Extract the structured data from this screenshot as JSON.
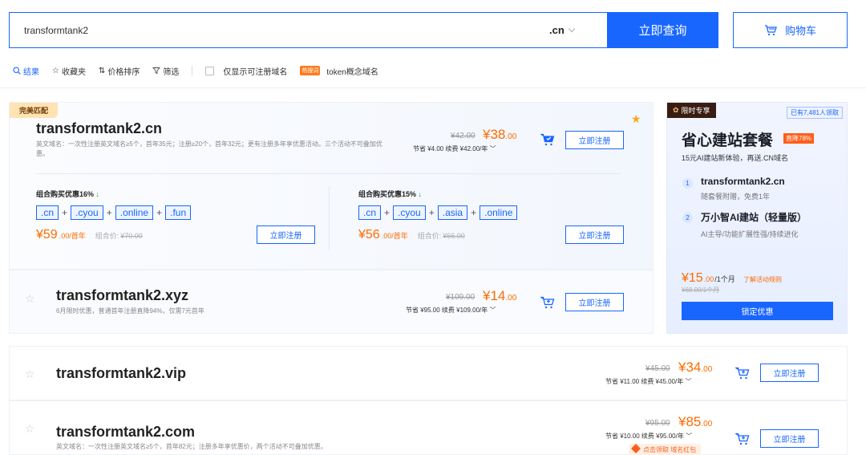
{
  "search": {
    "query": "transformtank2",
    "suffix": ".cn",
    "button_label": "立即查询",
    "cart_label": "购物车"
  },
  "toolbar": {
    "results": "结果",
    "favorites": "收藏夹",
    "sort_price": "价格排序",
    "filter": "筛选",
    "only_registrable": "仅显示可注册域名",
    "hot_badge": "热搜词",
    "token_concept": "token概念域名"
  },
  "exact": {
    "tag": "完美匹配",
    "name": "transformtank2.cn",
    "desc": "英文域名：一次性注册英文域名≥5个，首年35元；注册≥20个，首年32元；更有注册多年享优惠活动。三个活动不可叠加优惠。",
    "old_price": "¥42.00",
    "new_price_int": "¥38",
    "new_price_dec": ".00",
    "save": "节省 ¥4.00  续费 ¥42.00/年",
    "register": "立即注册",
    "bundles": [
      {
        "title": "组合购买优惠16%",
        "tlds": [
          ".cn",
          ".cyou",
          ".online",
          ".fun"
        ],
        "price_int": "¥59",
        "price_unit": ".00/首年",
        "ref_label": "组合价:",
        "ref_price": "¥70.00",
        "register": "立即注册"
      },
      {
        "title": "组合购买优惠15%",
        "tlds": [
          ".cn",
          ".cyou",
          ".asia",
          ".online"
        ],
        "price_int": "¥56",
        "price_unit": ".00/首年",
        "ref_label": "组合价:",
        "ref_price": "¥66.00",
        "register": "立即注册"
      }
    ]
  },
  "rows": [
    {
      "name": "transformtank2.xyz",
      "desc": "6月限时优惠，普通首年注册直降94%，仅需7元首年",
      "old_price": "¥109.00",
      "new_price_int": "¥14",
      "new_price_dec": ".00",
      "save": "节省 ¥95.00  续费 ¥109.00/年",
      "register": "立即注册"
    },
    {
      "name": "transformtank2.vip",
      "desc": "",
      "old_price": "¥45.00",
      "new_price_int": "¥34",
      "new_price_dec": ".00",
      "save": "节省 ¥11.00  续费 ¥45.00/年",
      "register": "立即注册"
    },
    {
      "name": "transformtank2.com",
      "desc": "英文域名：一次性注册英文域名≥5个，首年82元；注册多年享优惠价，两个活动不可叠加优惠。",
      "old_price": "¥95.00",
      "new_price_int": "¥85",
      "new_price_dec": ".00",
      "save": "节省 ¥10.00  续费 ¥95.00/年",
      "register": "立即注册",
      "red_packet": "点击领取 域名红包"
    }
  ],
  "promo": {
    "tag": "限时专享",
    "claimed": "已有7,481人领取",
    "title": "省心建站套餐",
    "hot": "直降78%",
    "subtitle": "15元AI建站新体验，再送.CN域名",
    "items": [
      {
        "num": "1",
        "title": "transformtank2.cn",
        "sub": "随套餐附赠，免费1年"
      },
      {
        "num": "2",
        "title": "万小智AI建站（轻量版）",
        "sub": "AI主导/功能扩展性强/持续进化"
      }
    ],
    "price_int": "¥15",
    "price_dec": ".00",
    "price_unit": "/1个月",
    "rules": "了解活动规则",
    "orig": "¥68.00/1个月",
    "button": "锁定优惠"
  },
  "colors": {
    "accent": "#1966ff",
    "price": "#ff6a00"
  }
}
